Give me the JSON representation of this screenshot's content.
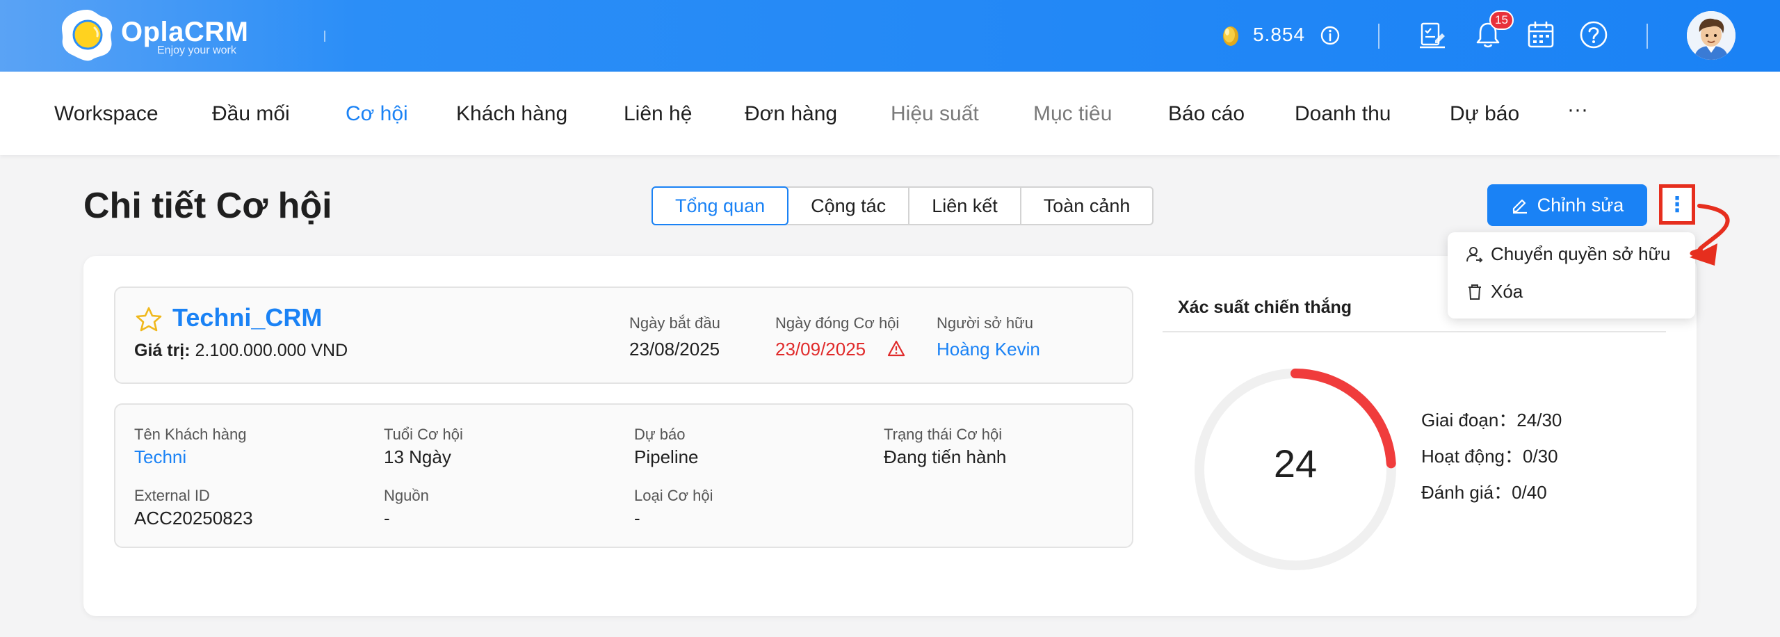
{
  "header": {
    "brand": "OplaCRM",
    "tagline": "Enjoy your work",
    "coins": "5.854",
    "notification_count": "15"
  },
  "nav": {
    "items": [
      {
        "label": "Workspace",
        "state": "normal"
      },
      {
        "label": "Đầu mối",
        "state": "normal"
      },
      {
        "label": "Cơ hội",
        "state": "active"
      },
      {
        "label": "Khách hàng",
        "state": "normal"
      },
      {
        "label": "Liên hệ",
        "state": "normal"
      },
      {
        "label": "Đơn hàng",
        "state": "normal"
      },
      {
        "label": "Hiệu suất",
        "state": "muted"
      },
      {
        "label": "Mục tiêu",
        "state": "muted"
      },
      {
        "label": "Báo cáo",
        "state": "normal"
      },
      {
        "label": "Doanh thu",
        "state": "normal"
      },
      {
        "label": "Dự báo",
        "state": "normal"
      }
    ],
    "more": "···"
  },
  "page": {
    "title": "Chi tiết Cơ hội",
    "tabs": [
      "Tổng quan",
      "Cộng tác",
      "Liên kết",
      "Toàn cảnh"
    ],
    "edit_label": "Chỉnh sửa",
    "more_label": "⋮"
  },
  "menu": {
    "transfer": "Chuyển quyền sở hữu",
    "delete": "Xóa"
  },
  "opportunity": {
    "name": "Techni_CRM",
    "value_label": "Giá trị:",
    "value": "2.100.000.000 VND",
    "start_date_label": "Ngày bắt đầu",
    "start_date": "23/08/2025",
    "close_date_label": "Ngày đóng Cơ hội",
    "close_date": "23/09/2025",
    "owner_label": "Người sở hữu",
    "owner": "Hoàng Kevin"
  },
  "details": {
    "customer_label": "Tên Khách hàng",
    "customer": "Techni",
    "age_label": "Tuổi Cơ hội",
    "age": "13 Ngày",
    "forecast_label": "Dự báo",
    "forecast": "Pipeline",
    "status_label": "Trạng thái Cơ hội",
    "status": "Đang tiến hành",
    "external_id_label": "External ID",
    "external_id": "ACC20250823",
    "source_label": "Nguồn",
    "source": "-",
    "type_label": "Loại Cơ hội",
    "type": "-"
  },
  "win": {
    "title": "Xác suất chiến thắng",
    "score": "24",
    "progress": 0.24,
    "stage": "Giai đoạn：24/30",
    "activity": "Hoạt động：0/30",
    "rating": "Đánh giá：0/40"
  },
  "colors": {
    "primary": "#1a82f5",
    "danger": "#e02a2a",
    "gauge_arc": "#f03c3c",
    "gauge_track": "#f0f0f0",
    "annotation": "#e62e1e"
  }
}
